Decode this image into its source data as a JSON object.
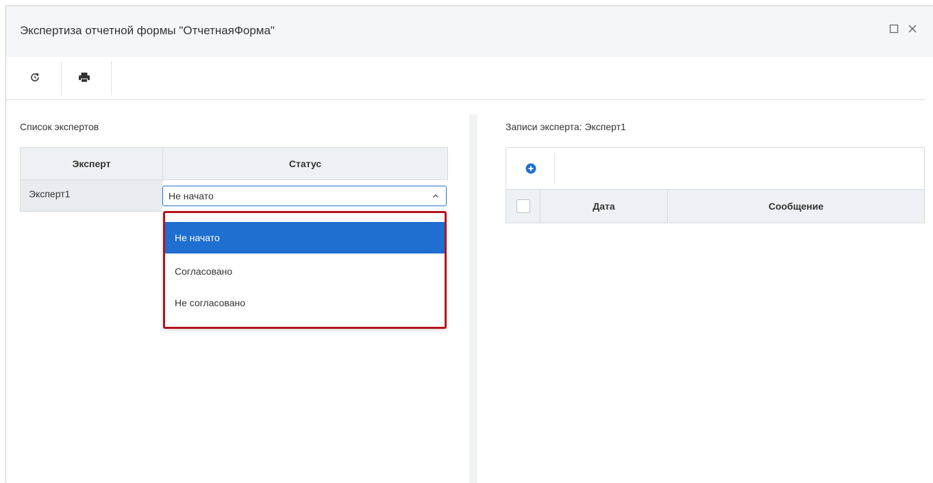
{
  "window": {
    "title": "Экспертиза отчетной формы \"ОтчетнаяФорма\""
  },
  "toolbar": {
    "refresh_icon": "refresh-icon",
    "print_icon": "print-icon"
  },
  "experts": {
    "section_label": "Список экспертов",
    "columns": [
      "Эксперт",
      "Статус"
    ],
    "rows": [
      {
        "expert": "Эксперт1",
        "status": "Не начато"
      }
    ],
    "status_options": [
      "Не начато",
      "Согласовано",
      "Не согласовано"
    ],
    "selected_option": "Не начато"
  },
  "records": {
    "section_label": "Записи эксперта: Эксперт1",
    "add_icon": "add-circle-icon",
    "columns": [
      "Дата",
      "Сообщение"
    ]
  },
  "colors": {
    "accent": "#1f6fd0",
    "highlight_border": "#b5121b",
    "header_bg": "#edf0f4",
    "titlebar_bg": "#f4f6f9"
  }
}
